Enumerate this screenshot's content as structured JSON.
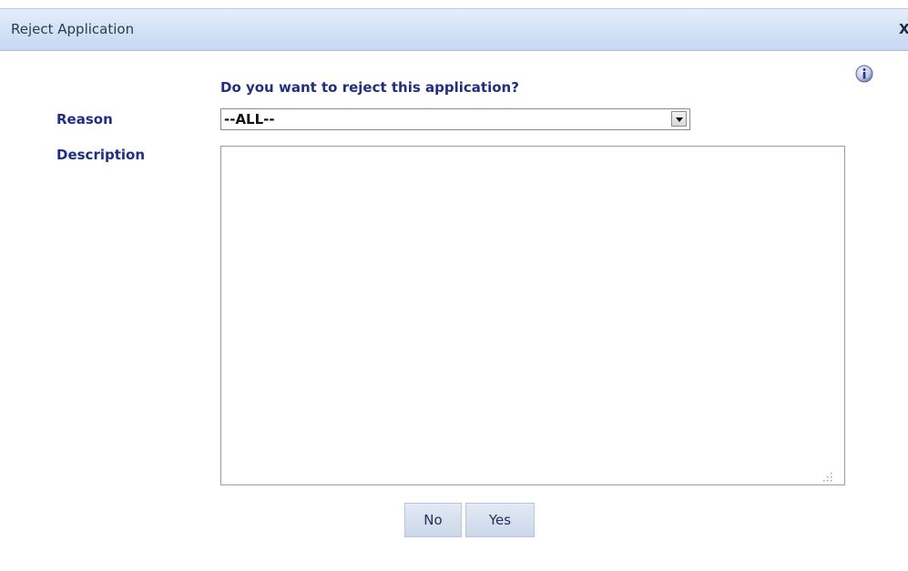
{
  "dialog": {
    "title": "Reject Application",
    "close_label": "X",
    "question": "Do you want to reject this application?",
    "reason_label": "Reason",
    "reason_selected": "--ALL--",
    "description_label": "Description",
    "description_value": "",
    "no_label": "No",
    "yes_label": "Yes"
  },
  "colors": {
    "label": "#1f2f82",
    "titlebar": "#d3e0f5",
    "button": "#cbd7ea"
  },
  "icons": {
    "info": "info-icon",
    "dropdown": "dropdown-arrow-icon",
    "close": "close-icon",
    "resize": "resize-grip-icon"
  }
}
